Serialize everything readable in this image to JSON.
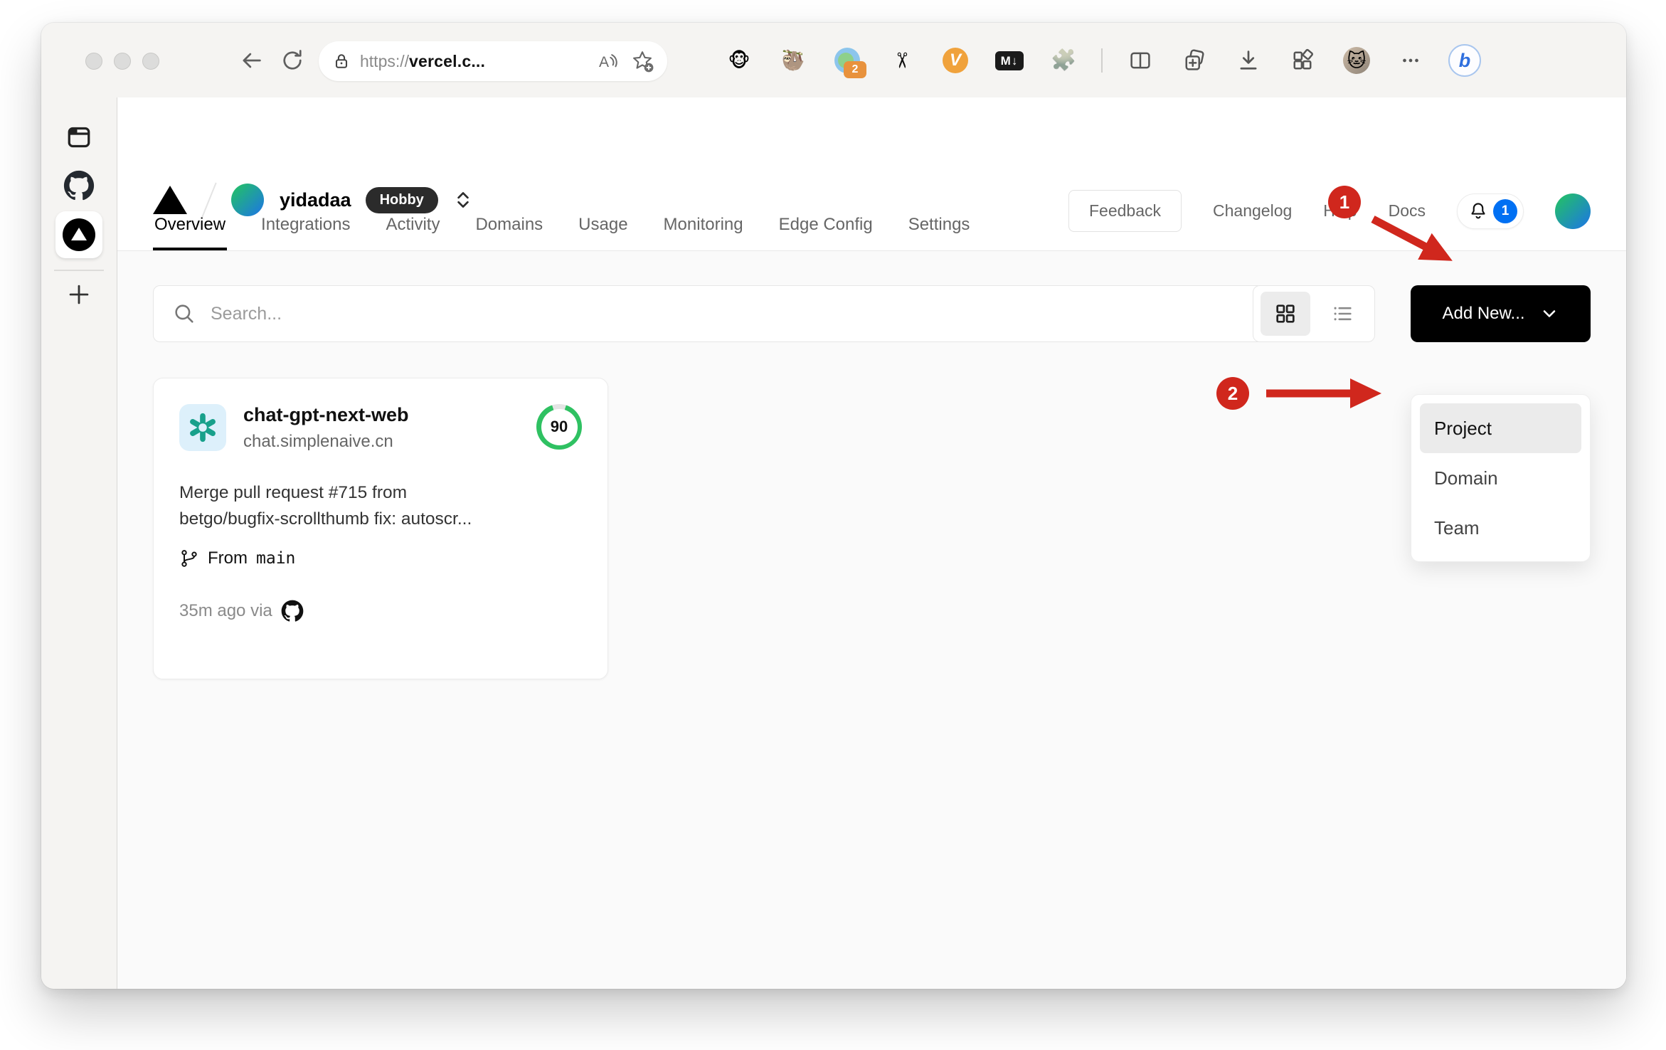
{
  "browser": {
    "url_scheme": "https://",
    "url_host": "vercel.c...",
    "ext_badge_count": "2",
    "markdown_ext_label": "M↓",
    "v_ext_label": "V",
    "bing_label": "b"
  },
  "vercel_header": {
    "team_name": "yidadaa",
    "plan": "Hobby",
    "feedback": "Feedback",
    "changelog": "Changelog",
    "help": "Help",
    "docs": "Docs",
    "notification_count": "1"
  },
  "tabs": {
    "items": [
      {
        "label": "Overview"
      },
      {
        "label": "Integrations"
      },
      {
        "label": "Activity"
      },
      {
        "label": "Domains"
      },
      {
        "label": "Usage"
      },
      {
        "label": "Monitoring"
      },
      {
        "label": "Edge Config"
      },
      {
        "label": "Settings"
      }
    ]
  },
  "toolbar": {
    "search_placeholder": "Search...",
    "add_new_label": "Add New..."
  },
  "dropdown": {
    "items": [
      {
        "label": "Project"
      },
      {
        "label": "Domain"
      },
      {
        "label": "Team"
      }
    ]
  },
  "annotations": {
    "step_1": "1",
    "step_2": "2",
    "arrow_color": "#d0271d"
  },
  "card": {
    "name": "chat-gpt-next-web",
    "domain": "chat.simplenaive.cn",
    "score": "90",
    "commit_line1": "Merge pull request #715 from",
    "commit_line2": "betgo/bugfix-scrollthumb fix: autoscr...",
    "branch_prefix": "From",
    "branch_name": "main",
    "deployed": "35m ago via"
  },
  "colors": {
    "ring_green": "#2fc162",
    "notification_blue": "#0070f3",
    "annotation_red": "#d0271d"
  }
}
